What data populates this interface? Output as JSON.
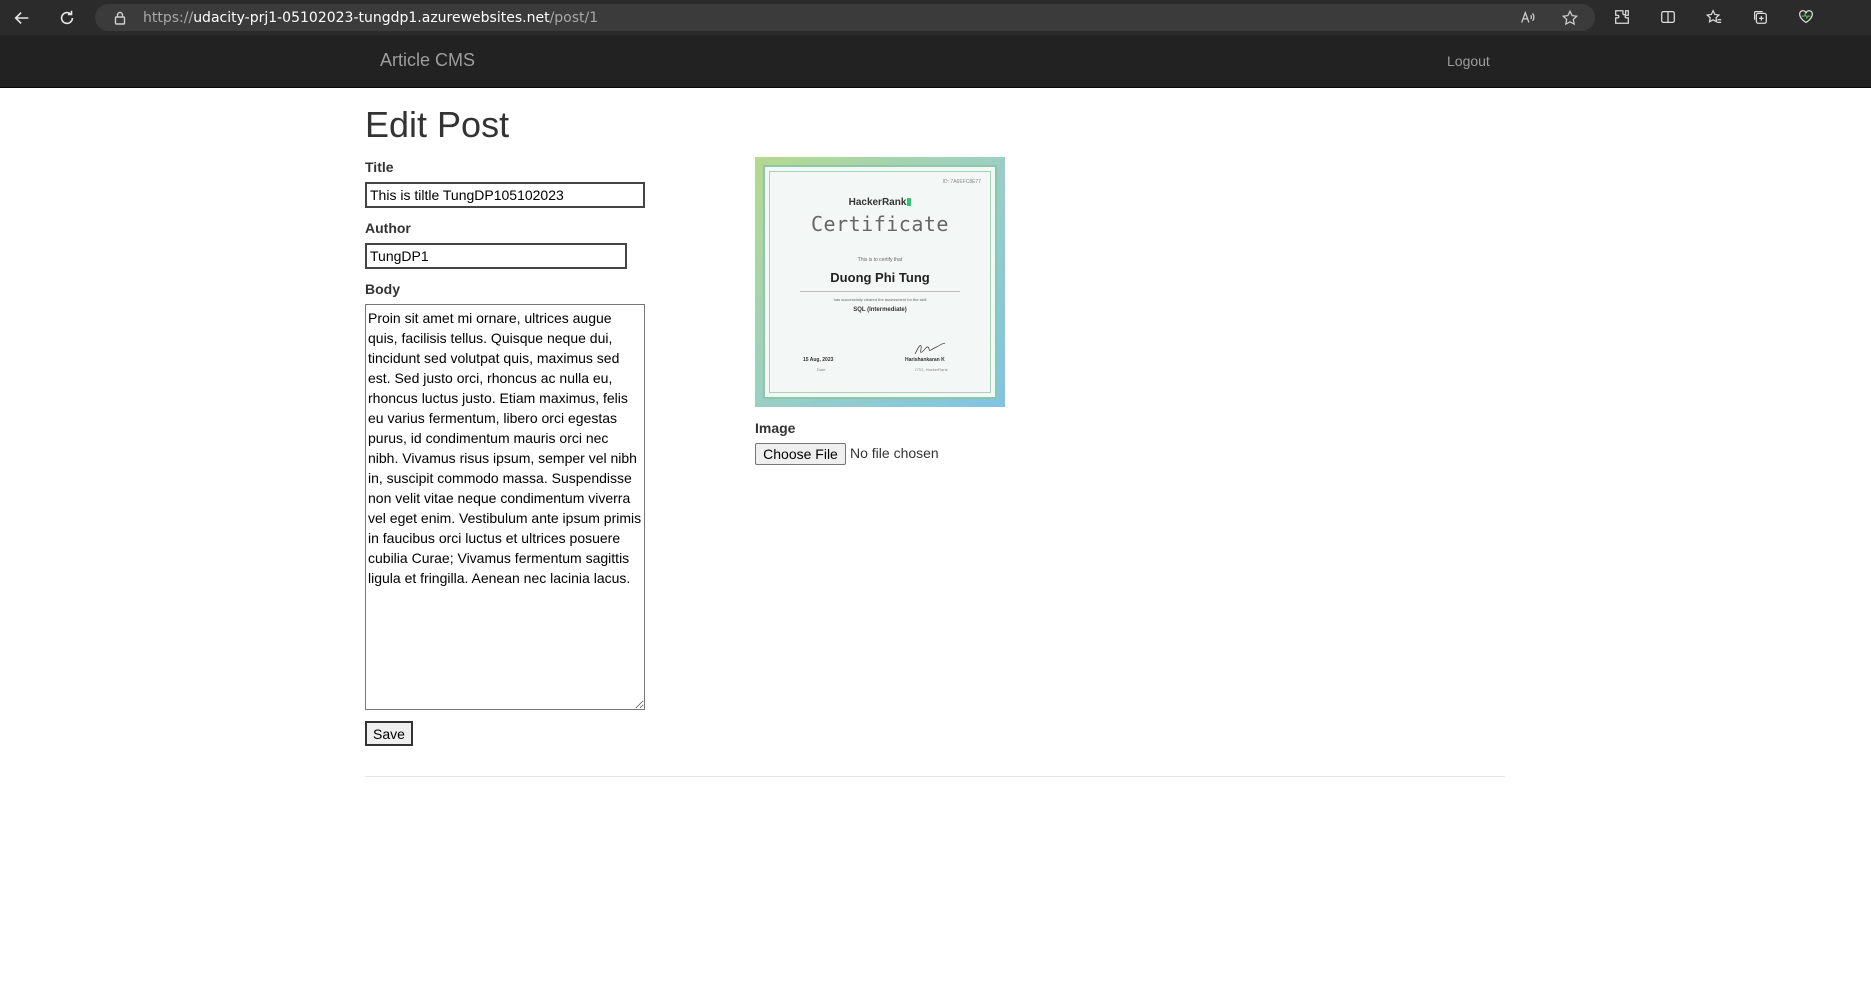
{
  "browser": {
    "url_prefix": "https://",
    "url_host": "udacity-prj1-05102023-tungdp1.azurewebsites.net",
    "url_path": "/post/1"
  },
  "navbar": {
    "brand": "Article CMS",
    "logout": "Logout"
  },
  "page": {
    "title": "Edit Post"
  },
  "form": {
    "title_label": "Title",
    "title_value": "This is tiltle TungDP105102023",
    "author_label": "Author",
    "author_value": "TungDP1",
    "body_label": "Body",
    "body_value": "Proin sit amet mi ornare, ultrices augue quis, facilisis tellus. Quisque neque dui, tincidunt sed volutpat quis, maximus sed est. Sed justo orci, rhoncus ac nulla eu, rhoncus luctus justo. Etiam maximus, felis eu varius fermentum, libero orci egestas purus, id condimentum mauris orci nec nibh. Vivamus risus ipsum, semper vel nibh in, suscipit commodo massa. Suspendisse non velit vitae neque condimentum viverra vel eget enim. Vestibulum ante ipsum primis in faucibus orci luctus et ultrices posuere cubilia Curae; Vivamus fermentum sagittis ligula et fringilla. Aenean nec lacinia lacus.",
    "save_label": "Save",
    "image_label": "Image",
    "choose_file_label": "Choose File",
    "file_status": "No file chosen"
  },
  "certificate": {
    "id": "ID: 7A6EFC8E77",
    "brand": "HackerRank",
    "heading": "Certificate",
    "certify_text": "This is to certify that",
    "name": "Duong Phi Tung",
    "cleared_text": "has successfully cleared the assessment for the skill",
    "course": "SQL (Intermediate)",
    "date": "15 Aug, 2023",
    "date_caption": "Date",
    "signer": "Harishankaran K",
    "signer_caption": "CTO, HackerRank"
  },
  "colors": {
    "navbar_bg": "#222222",
    "navbar_text": "#9d9d9d",
    "browser_bg": "#2b2b2b"
  }
}
